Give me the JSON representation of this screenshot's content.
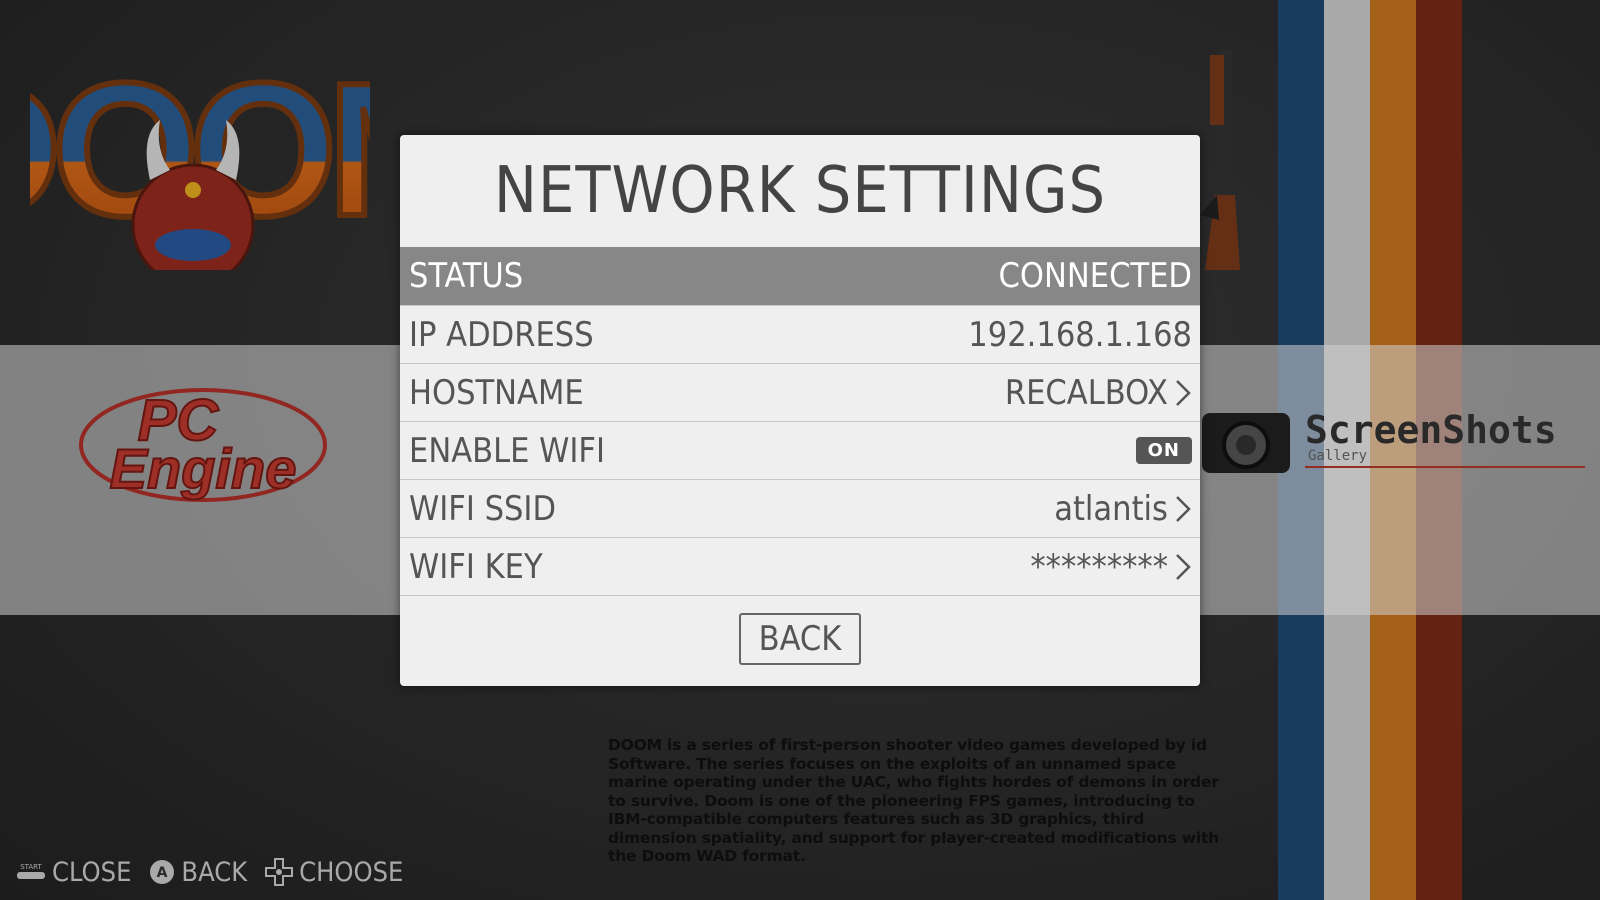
{
  "dialog": {
    "title": "NETWORK SETTINGS",
    "rows": [
      {
        "label": "STATUS",
        "value": "CONNECTED"
      },
      {
        "label": "IP ADDRESS",
        "value": "192.168.1.168"
      },
      {
        "label": "HOSTNAME",
        "value": "RECALBOX"
      },
      {
        "label": "ENABLE WIFI",
        "value": "ON"
      },
      {
        "label": "WIFI SSID",
        "value": "atlantis"
      },
      {
        "label": "WIFI KEY",
        "value": "*********"
      }
    ],
    "back_label": "BACK"
  },
  "background": {
    "description": "DOOM is a series of first-person shooter video games developed by id Software. The series focuses on the exploits of an unnamed space marine operating under the UAC, who fights hordes of demons in order to survive. Doom is one of the pioneering FPS games, introducing to IBM-compatible computers features such as 3D graphics, third dimension spatiality, and support for player-created modifications with the Doom WAD format.",
    "logos": {
      "doom_text": "DOOM",
      "pce_line1": "PC",
      "pce_line2": "Engine",
      "screenshots": "ScreenShots",
      "screenshots_sub": "Gallery"
    }
  },
  "helpbar": {
    "items": [
      {
        "icon": "start-button-icon",
        "label": "CLOSE",
        "icon_text": "START"
      },
      {
        "icon": "a-button-icon",
        "label": "BACK",
        "icon_text": "A"
      },
      {
        "icon": "dpad-icon",
        "label": "CHOOSE"
      }
    ]
  },
  "colors": {
    "stripe_blue": "#1d4a73",
    "stripe_white": "#cfcfcf",
    "stripe_orange": "#c8761e",
    "stripe_red": "#7a2a16",
    "selected_row": "#878787",
    "dialog_bg": "#efefef"
  }
}
